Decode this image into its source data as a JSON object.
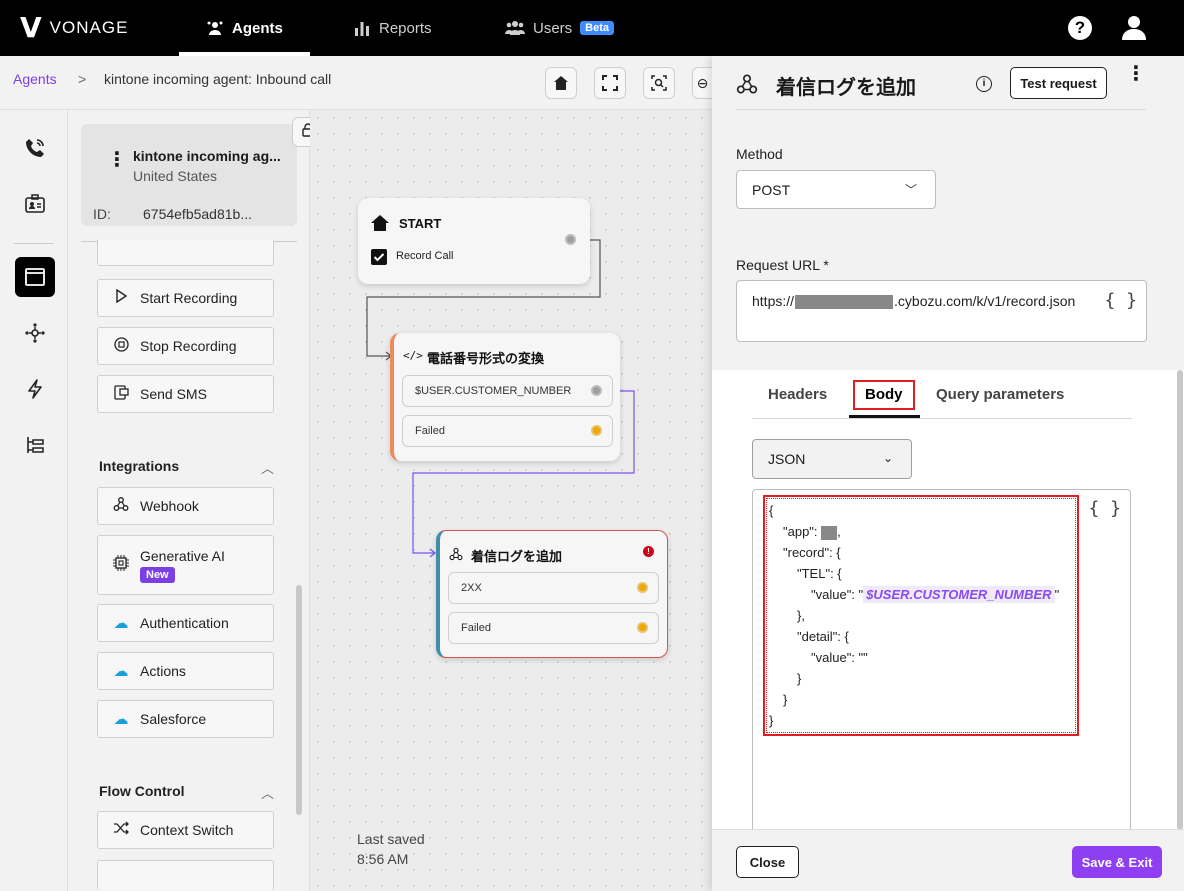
{
  "header": {
    "brand": "VONAGE",
    "nav": [
      {
        "label": "Agents",
        "icon": "agents-icon"
      },
      {
        "label": "Reports",
        "icon": "bar-chart-icon"
      },
      {
        "label": "Users",
        "icon": "users-icon",
        "badge": "Beta"
      }
    ]
  },
  "breadcrumb": {
    "root": "Agents",
    "separator": ">",
    "current": "kintone incoming agent: Inbound call"
  },
  "agent": {
    "name": "kintone incoming ag...",
    "country": "United States",
    "id_label": "ID:",
    "id": "6754efb5ad81b..."
  },
  "components": {
    "actions": [
      "Start Recording",
      "Stop Recording",
      "Send SMS"
    ],
    "integrations_title": "Integrations",
    "integrations": [
      "Webhook",
      "Generative AI",
      "Authentication",
      "Actions",
      "Salesforce"
    ],
    "new_badge": "New",
    "flow_control_title": "Flow Control",
    "flow_control": [
      "Context Switch"
    ]
  },
  "canvas": {
    "start": {
      "title": "START",
      "row": "Record Call"
    },
    "convert": {
      "title": "電話番号形式の変換",
      "rows": [
        "$USER.CUSTOMER_NUMBER",
        "Failed"
      ]
    },
    "webhook": {
      "title": "着信ログを追加",
      "rows": [
        "2XX",
        "Failed"
      ]
    },
    "last_saved_label": "Last saved",
    "last_saved_time": "8:56 AM"
  },
  "drawer": {
    "title": "着信ログを追加",
    "test_button": "Test request",
    "method_label": "Method",
    "method_value": "POST",
    "url_label": "Request URL *",
    "url_prefix": "https://",
    "url_suffix": ".cybozu.com/k/v1/record.json",
    "braces": "{ }",
    "tabs": [
      "Headers",
      "Body",
      "Query parameters"
    ],
    "format": "JSON",
    "code": {
      "l1": "{",
      "l2a": "\"app\": ",
      "l2b": ",",
      "l3": "\"record\": {",
      "l4": "\"TEL\": {",
      "l5a": "\"value\": \"",
      "l5var": "$USER.CUSTOMER_NUMBER",
      "l5b": "\"",
      "l6": "},",
      "l7": "\"detail\": {",
      "l8": "\"value\": \"\"",
      "l9": "}",
      "l10": "}",
      "l11": "}"
    },
    "close": "Close",
    "save": "Save & Exit"
  },
  "colors": {
    "accent": "#8d3ff1",
    "link": "#7b3fe4",
    "highlight": "#e02020",
    "beta": "#3d8bfd"
  }
}
